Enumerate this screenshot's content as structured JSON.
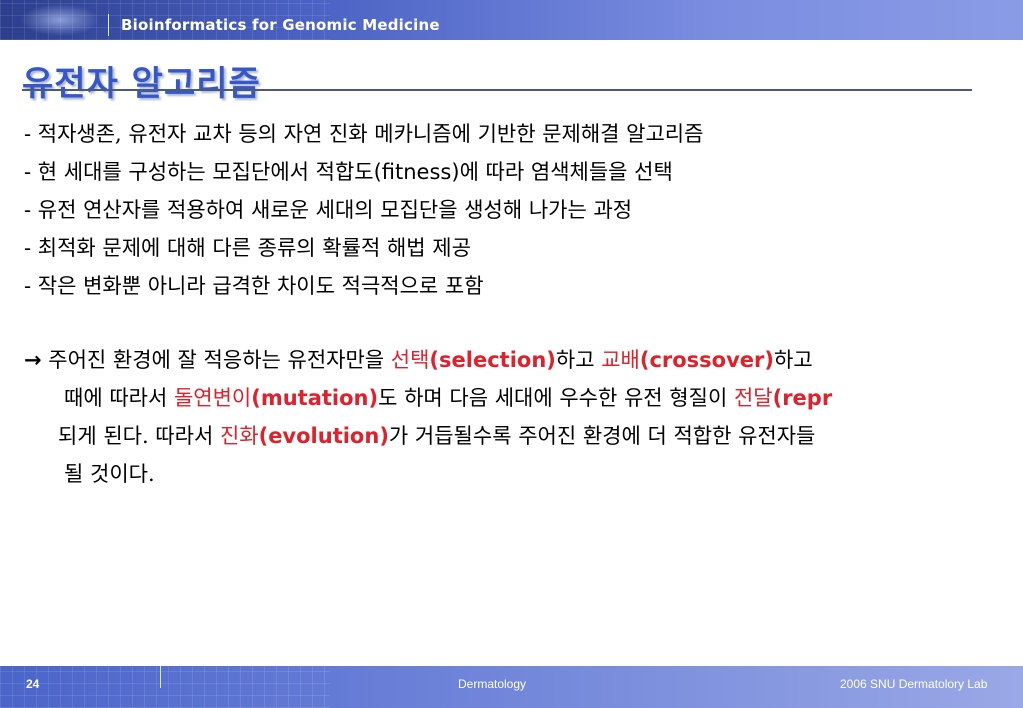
{
  "header": {
    "title": "Bioinformatics for Genomic Medicine"
  },
  "page_title": "유전자 알고리즘",
  "bullets": [
    "- 적자생존, 유전자 교차 등의 자연 진화 메카니즘에 기반한 문제해결 알고리즘",
    {
      "pre": "- 현 세대를 구성하는 모집단에서 적합도",
      "term": "(fitness)",
      "post": "에 따라 염색체들을 선택"
    },
    "- 유전 연산자를 적용하여 새로운 세대의 모집단을 생성해 나가는 과정",
    "- 최적화 문제에 대해 다른 종류의 확률적 해법 제공",
    "- 작은 변화뿐 아니라 급격한 차이도 적극적으로 포함"
  ],
  "paragraph": {
    "line1": {
      "arrow": "→",
      "t1": " 주어진 환경에 잘 적응하는 유전자만을 ",
      "k1": "선택",
      "e1": "(selection)",
      "t2": "하고 ",
      "k2": "교배",
      "e2": "(crossover)",
      "t3": "하고"
    },
    "line2": {
      "t1": "때에 따라서 ",
      "k1": "돌연변이",
      "e1": "(mutation)",
      "t2": "도 하며 다음 세대에 우수한 유전 형질이 ",
      "k2": "전달",
      "e2": "(repr"
    },
    "line3": {
      "t1": "되게 된다. 따라서 ",
      "k1": "진화",
      "e1": "(evolution)",
      "t2": "가 거듭될수록 주어진 환경에 더 적합한 유전자들"
    },
    "line4": {
      "t1": "될 것이다."
    }
  },
  "footer": {
    "page_number": "24",
    "center": "Dermatology",
    "right": "2006 SNU Dermatolory Lab"
  },
  "colors": {
    "title": "#3557c8",
    "highlight": "#e0202a",
    "bar": "#4a64c8"
  }
}
